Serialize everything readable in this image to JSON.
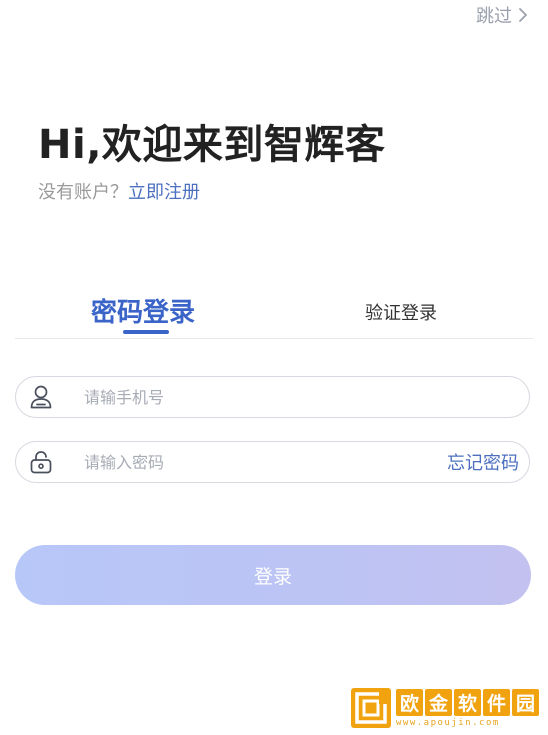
{
  "header": {
    "skip_label": "跳过"
  },
  "welcome": {
    "title": "Hi,欢迎来到智辉客",
    "no_account_text": "没有账户？",
    "register_link": "立即注册"
  },
  "tabs": [
    {
      "label": "密码登录",
      "active": true
    },
    {
      "label": "验证登录",
      "active": false
    }
  ],
  "form": {
    "phone_placeholder": "请输手机号",
    "password_placeholder": "请输入密码",
    "forgot_label": "忘记密码",
    "login_label": "登录"
  },
  "watermark": {
    "chars": [
      "欧",
      "金",
      "软",
      "件",
      "园"
    ],
    "url": "www.apoujin.com"
  },
  "colors": {
    "accent": "#3a64c8",
    "link": "#4c6fc0",
    "button_start": "#b7c7f8",
    "button_end": "#c3c1f0",
    "watermark": "#f0a20f"
  },
  "icons": {
    "skip": "chevron-right-icon",
    "phone": "user-icon",
    "password": "lock-icon",
    "watermark_logo": "watermark-logo-icon"
  }
}
